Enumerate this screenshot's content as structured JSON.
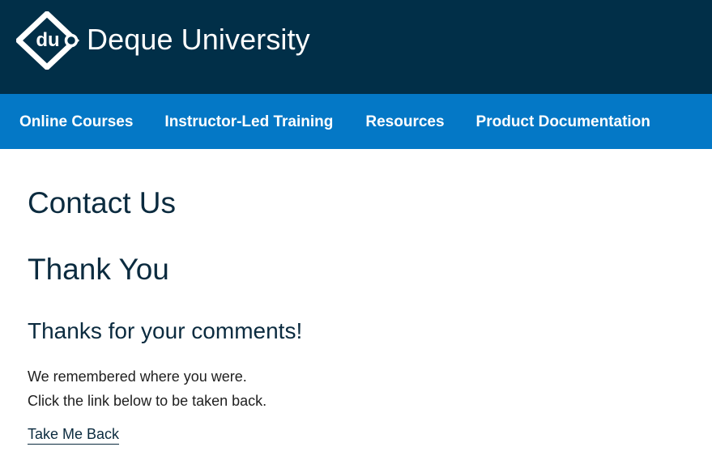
{
  "brand": {
    "logo_text": "Deque University",
    "logo_icon_text": "du",
    "header_color": "#012f48",
    "nav_color": "#0478c6"
  },
  "nav": {
    "items": [
      {
        "label": "Online Courses"
      },
      {
        "label": "Instructor-Led Training"
      },
      {
        "label": "Resources"
      },
      {
        "label": "Product Documentation"
      }
    ]
  },
  "main": {
    "page_title": "Contact Us",
    "thank_you_heading": "Thank You",
    "subheading": "Thanks for your comments!",
    "message_line_1": "We remembered where you were.",
    "message_line_2": "Click the link below to be taken back.",
    "link_label": "Take Me Back"
  }
}
